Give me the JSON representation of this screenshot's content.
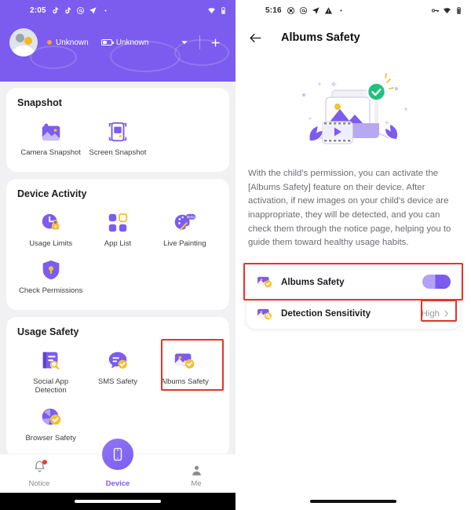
{
  "left": {
    "status_bar": {
      "time": "2:05",
      "icons": [
        "tiktok-icon",
        "tiktok-icon",
        "at-circle-icon",
        "send-icon",
        "dot-icon"
      ],
      "right_icons": [
        "wifi-icon",
        "battery-icon"
      ]
    },
    "header": {
      "avatar": "avatar",
      "name": "Unknown",
      "battery": "Unknown",
      "dropdown_icon": "chevron-down-icon",
      "add_icon": "plus-icon"
    },
    "sections": [
      {
        "title": "Snapshot",
        "items": [
          {
            "label": "Camera Snapshot",
            "icon": "camera-snapshot-icon",
            "highlighted": false
          },
          {
            "label": "Screen Snapshot",
            "icon": "screen-snapshot-icon",
            "highlighted": false
          }
        ]
      },
      {
        "title": "Device Activity",
        "items": [
          {
            "label": "Usage Limits",
            "icon": "usage-limits-icon",
            "highlighted": false
          },
          {
            "label": "App List",
            "icon": "app-list-icon",
            "highlighted": false
          },
          {
            "label": "Live Painting",
            "icon": "live-painting-icon",
            "badge": "Beta",
            "highlighted": false
          },
          {
            "label": "Check Permissions",
            "icon": "check-permissions-icon",
            "highlighted": false
          }
        ]
      },
      {
        "title": "Usage Safety",
        "items": [
          {
            "label": "Social App Detection",
            "icon": "social-app-detection-icon",
            "highlighted": false
          },
          {
            "label": "SMS Safety",
            "icon": "sms-safety-icon",
            "highlighted": false
          },
          {
            "label": "Albums Safety",
            "icon": "albums-safety-icon",
            "highlighted": true
          },
          {
            "label": "Browser Safety",
            "icon": "browser-safety-icon",
            "highlighted": false
          }
        ]
      }
    ],
    "bottom_nav": [
      {
        "label": "Notice",
        "icon": "bell-icon",
        "active": false,
        "badge": true
      },
      {
        "label": "Device",
        "icon": "phone-icon",
        "active": true
      },
      {
        "label": "Me",
        "icon": "person-icon",
        "active": false
      }
    ]
  },
  "right": {
    "status_bar": {
      "time": "5:16",
      "icons": [
        "lifebuoy-icon",
        "at-circle-icon",
        "send-icon",
        "warning-icon",
        "dot-icon"
      ],
      "right_icons": [
        "vpn-key-icon",
        "wifi-icon",
        "battery-icon"
      ]
    },
    "app_bar": {
      "back_icon": "back-arrow-icon",
      "title": "Albums Safety"
    },
    "illustration": "albums-safety-illustration",
    "description": "With the child's permission, you can activate the [Albums Safety] feature on their device. After activation, if new images on your child's device are inappropriate, they will be detected, and you can check them through the notice page, helping you to guide them toward healthy usage habits.",
    "settings": [
      {
        "label": "Albums Safety",
        "icon": "albums-safety-shield-icon",
        "control": "toggle",
        "value": "on",
        "highlighted": true
      },
      {
        "label": "Detection Sensitivity",
        "icon": "albums-detection-icon",
        "control": "value-chevron",
        "value": "High",
        "chevron_icon": "chevron-right-icon",
        "highlighted": true
      }
    ]
  },
  "colors": {
    "brand_purple": "#7b5cef",
    "accent_yellow": "#f5c034",
    "highlight_red": "#e8322a",
    "page_bg": "#f1f1f3"
  }
}
